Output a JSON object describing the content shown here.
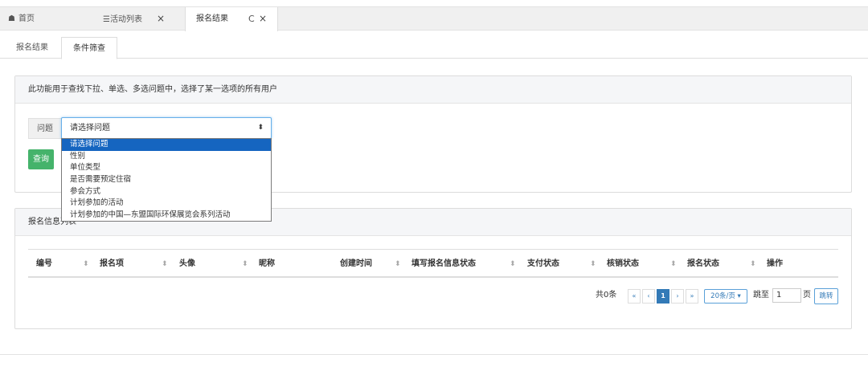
{
  "top_tabs": {
    "home": {
      "icon": "home-icon",
      "label": "首页"
    },
    "activity_list": {
      "icon": "list-icon",
      "label": "活动列表",
      "close": "×"
    },
    "result": {
      "label": "报名结果",
      "refresh": "C",
      "close": "×"
    }
  },
  "sub_tabs": [
    "报名结果",
    "条件筛查"
  ],
  "filter_panel": {
    "title": "此功能用于查找下拉、单选、多选问题中，选择了某一选项的所有用户",
    "question_label": "问题",
    "select_value": "请选择问题",
    "select_arrow": "⬍",
    "options": [
      "请选择问题",
      "性别",
      "单位类型",
      "是否需要预定住宿",
      "参会方式",
      "计划参加的活动",
      "计划参加的中国—东盟国际环保展览会系列活动"
    ],
    "query_button": "查询"
  },
  "list_panel": {
    "title": "报名信息列表",
    "columns": [
      "编号",
      "报名项",
      "头像",
      "昵称",
      "创建时间",
      "填写报名信息状态",
      "支付状态",
      "核销状态",
      "报名状态",
      "操作"
    ],
    "sort_glyph": "⬍",
    "pagination": {
      "total": "共0条",
      "first": "«",
      "prev": "‹",
      "current": "1",
      "next": "›",
      "last": "»",
      "page_size": "20条/页 ▾",
      "jump_label": "跳至",
      "jump_value": "1",
      "page_unit": "页",
      "go_button": "跳转"
    }
  },
  "colors": {
    "accent": "#337ab7",
    "query_button": "#45b36b",
    "selected_option": "#1565c0"
  }
}
